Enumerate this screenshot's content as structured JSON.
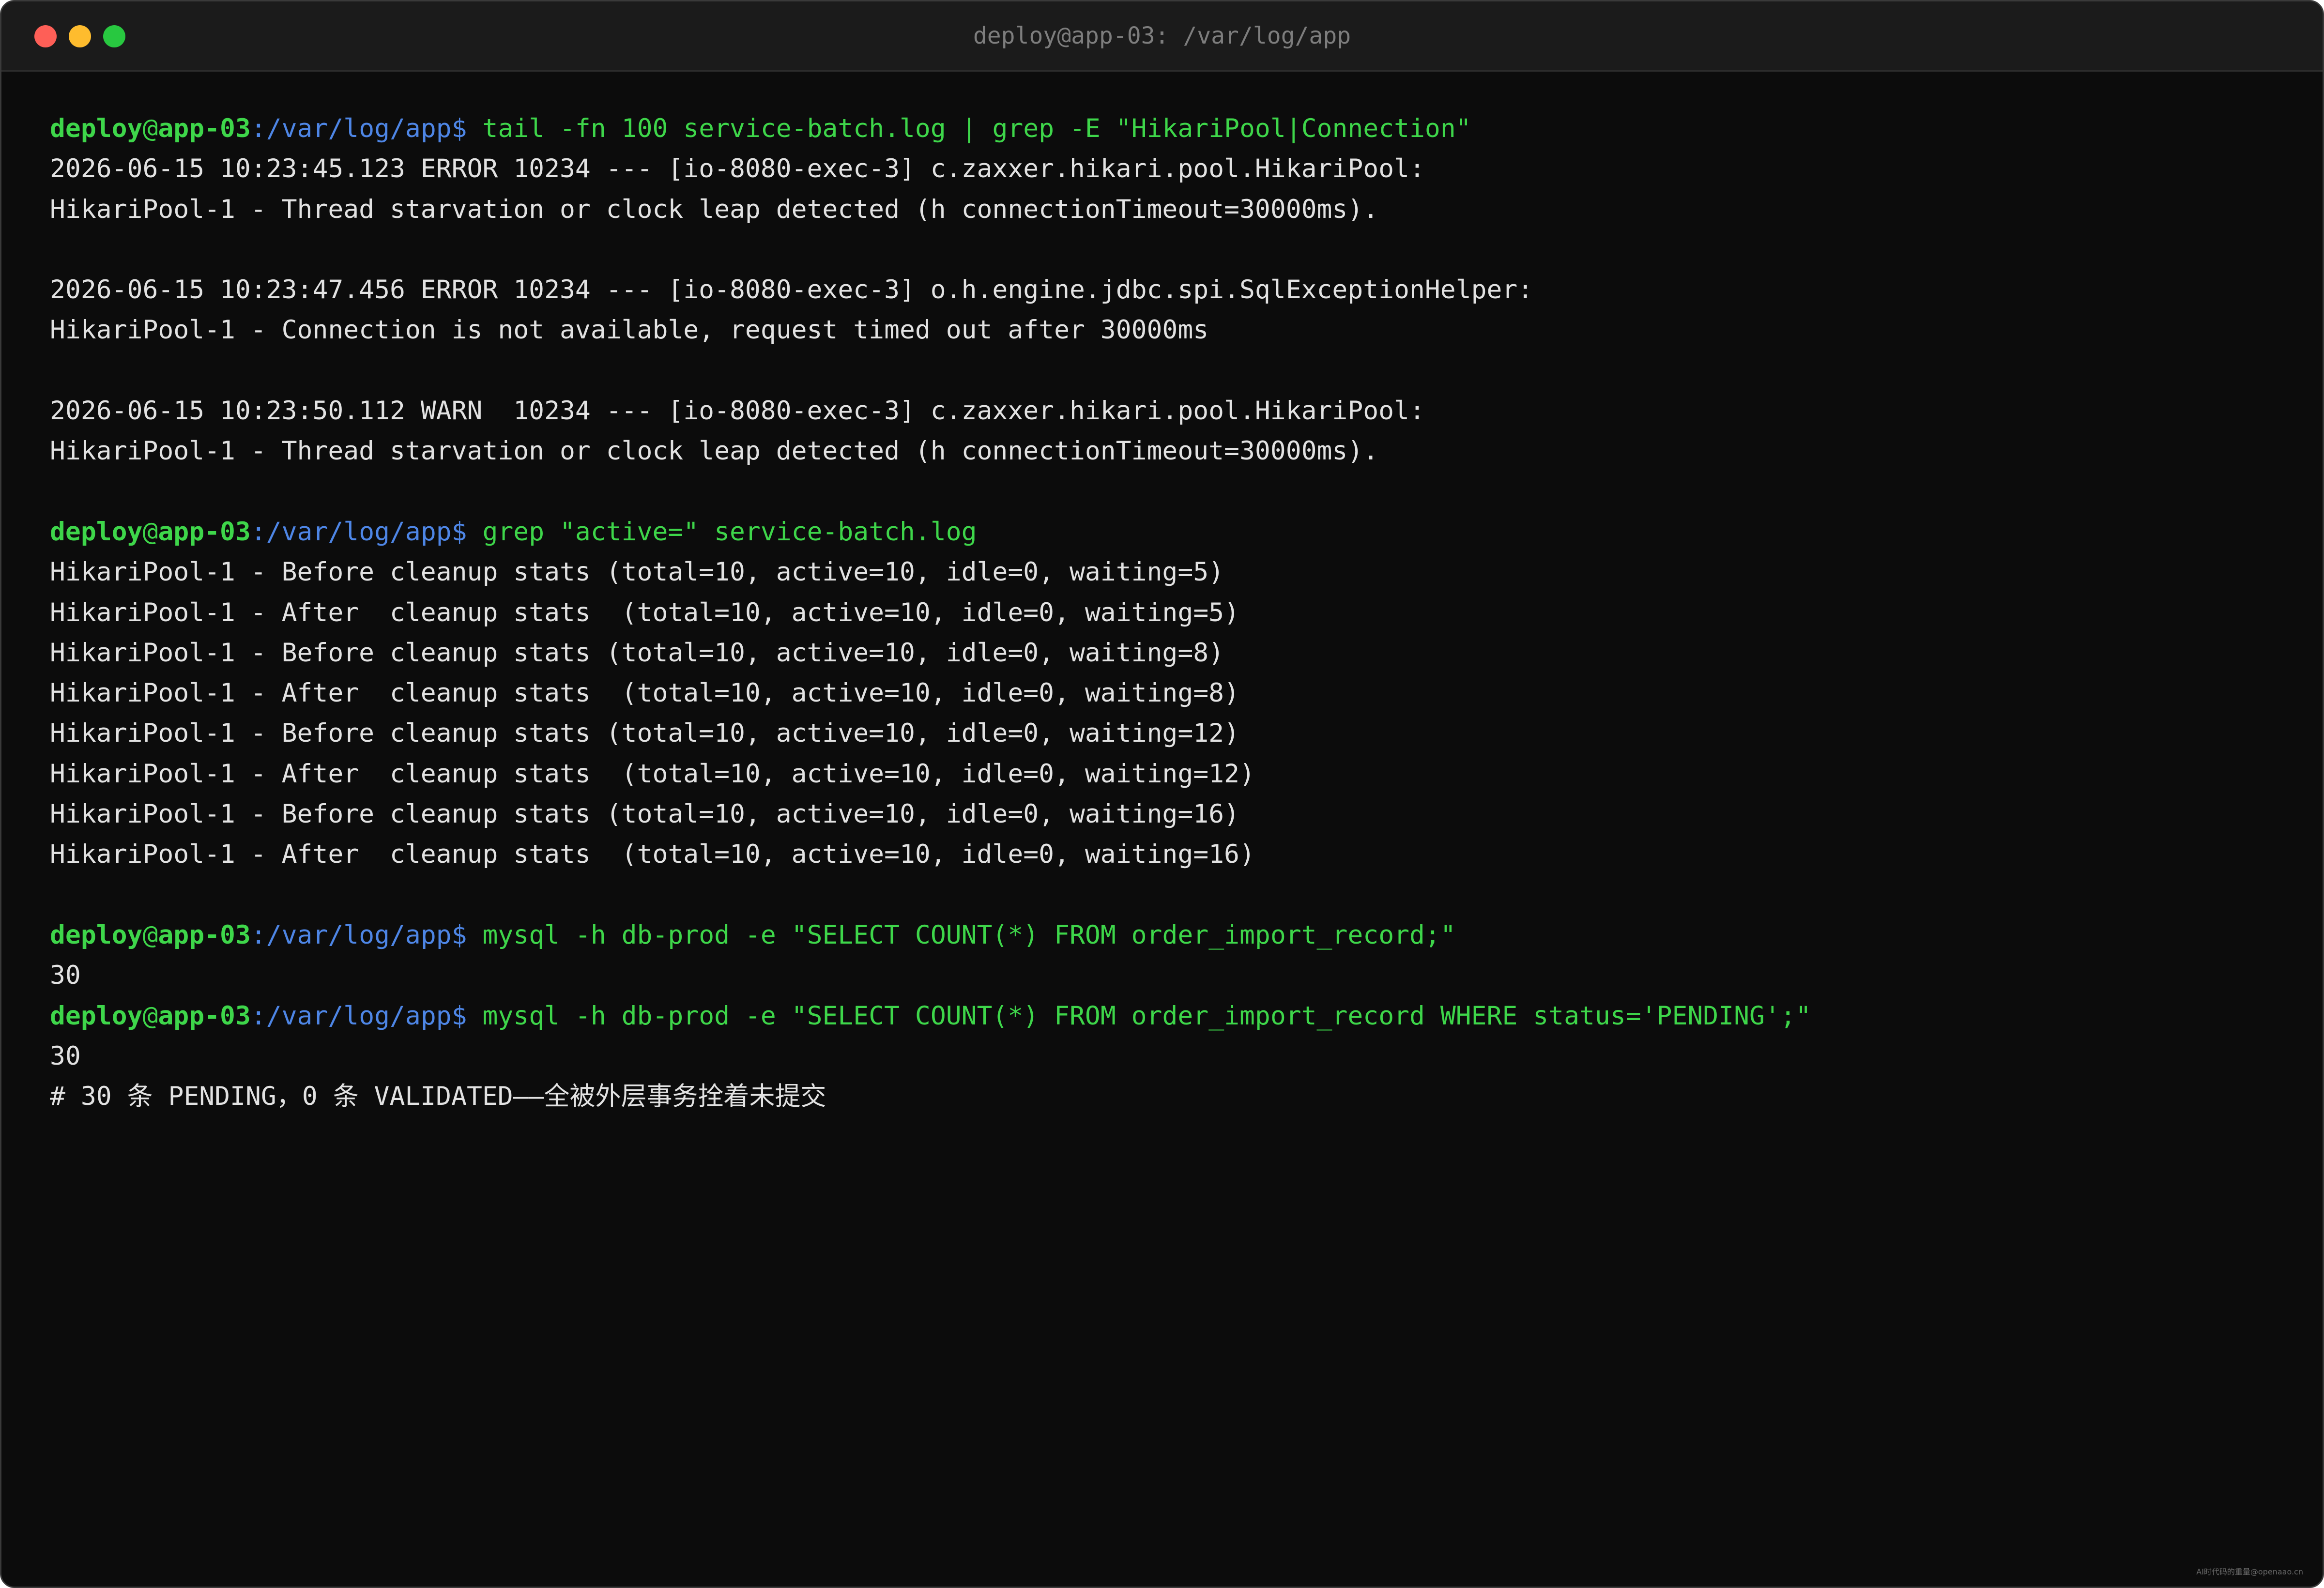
{
  "window": {
    "title": "deploy@app-03: /var/log/app"
  },
  "prompt": {
    "user": "deploy",
    "at": "@",
    "host": "app-03",
    "path": ":/var/log/app",
    "dollar": "$ "
  },
  "terminal": {
    "lines": [
      {
        "type": "cmd",
        "text": "tail -fn 100 service-batch.log | grep -E \"HikariPool|Connection\""
      },
      {
        "type": "out",
        "text": "2026-06-15 10:23:45.123 ERROR 10234 --- [io-8080-exec-3] c.zaxxer.hikari.pool.HikariPool:"
      },
      {
        "type": "out",
        "text": "HikariPool-1 - Thread starvation or clock leap detected (h connectionTimeout=30000ms)."
      },
      {
        "type": "out",
        "text": ""
      },
      {
        "type": "out",
        "text": "2026-06-15 10:23:47.456 ERROR 10234 --- [io-8080-exec-3] o.h.engine.jdbc.spi.SqlExceptionHelper:"
      },
      {
        "type": "out",
        "text": "HikariPool-1 - Connection is not available, request timed out after 30000ms"
      },
      {
        "type": "out",
        "text": ""
      },
      {
        "type": "out",
        "text": "2026-06-15 10:23:50.112 WARN  10234 --- [io-8080-exec-3] c.zaxxer.hikari.pool.HikariPool:"
      },
      {
        "type": "out",
        "text": "HikariPool-1 - Thread starvation or clock leap detected (h connectionTimeout=30000ms)."
      },
      {
        "type": "out",
        "text": ""
      },
      {
        "type": "cmd",
        "text": "grep \"active=\" service-batch.log"
      },
      {
        "type": "out",
        "text": "HikariPool-1 - Before cleanup stats (total=10, active=10, idle=0, waiting=5)"
      },
      {
        "type": "out",
        "text": "HikariPool-1 - After  cleanup stats  (total=10, active=10, idle=0, waiting=5)"
      },
      {
        "type": "out",
        "text": "HikariPool-1 - Before cleanup stats (total=10, active=10, idle=0, waiting=8)"
      },
      {
        "type": "out",
        "text": "HikariPool-1 - After  cleanup stats  (total=10, active=10, idle=0, waiting=8)"
      },
      {
        "type": "out",
        "text": "HikariPool-1 - Before cleanup stats (total=10, active=10, idle=0, waiting=12)"
      },
      {
        "type": "out",
        "text": "HikariPool-1 - After  cleanup stats  (total=10, active=10, idle=0, waiting=12)"
      },
      {
        "type": "out",
        "text": "HikariPool-1 - Before cleanup stats (total=10, active=10, idle=0, waiting=16)"
      },
      {
        "type": "out",
        "text": "HikariPool-1 - After  cleanup stats  (total=10, active=10, idle=0, waiting=16)"
      },
      {
        "type": "out",
        "text": ""
      },
      {
        "type": "cmd",
        "text": "mysql -h db-prod -e \"SELECT COUNT(*) FROM order_import_record;\""
      },
      {
        "type": "out",
        "text": "30"
      },
      {
        "type": "cmd",
        "text": "mysql -h db-prod -e \"SELECT COUNT(*) FROM order_import_record WHERE status='PENDING';\""
      },
      {
        "type": "out",
        "text": "30"
      },
      {
        "type": "out",
        "text": "# 30 条 PENDING，0 条 VALIDATED——全被外层事务拴着未提交"
      }
    ]
  },
  "watermark": "AI时代码的重量@openaao.cn",
  "colors": {
    "background": "#0c0c0c",
    "prompt_green": "#3ed64a",
    "prompt_path_blue": "#4e86e6",
    "output_text": "#e2e2e2"
  }
}
